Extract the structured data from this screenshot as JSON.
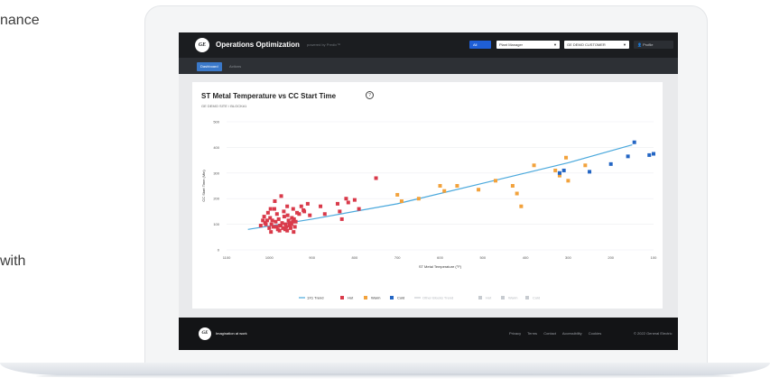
{
  "side_text": {
    "top": "nance",
    "bottom": "with"
  },
  "app": {
    "title": "Operations Optimization",
    "subtitle": "powered by Predix™",
    "logo": "GE"
  },
  "topbar": {
    "all_button": "All",
    "plant_select": "Plant Manager",
    "customer_select": "GE DEMO CUSTOMER",
    "user_menu": "Profile"
  },
  "tabs": [
    {
      "label": "Dashboard",
      "active": true
    },
    {
      "label": "Actions",
      "active": false
    }
  ],
  "chart": {
    "title": "ST Metal Temperature vs CC Start Time",
    "subtitle": "GE DEMO SITE / BLOCK#1",
    "info_icon": "info-icon"
  },
  "chart_data": {
    "type": "scatter",
    "title": "ST Metal Temperature vs CC Start Time",
    "subtitle": "GE DEMO SITE / BLOCK#1",
    "xlabel": "ST Metal Temperature (°F)",
    "ylabel": "CC Start Time (Min)",
    "x_ticks": [
      "1100",
      "1000",
      "900",
      "800",
      "700",
      "600",
      "500",
      "400",
      "300",
      "200",
      "100"
    ],
    "y_ticks": [
      "500",
      "400",
      "300",
      "200",
      "100",
      "0"
    ],
    "xlim": [
      1100,
      100
    ],
    "ylim": [
      0,
      500
    ],
    "grid": true,
    "legend_position": "bottom",
    "legend": [
      "1X1 Trend",
      "Hot",
      "Warm",
      "Cold",
      "Other Blocks Trend",
      "Hot",
      "Warm",
      "Cold"
    ],
    "colors": {
      "trend": "#4aa8dc",
      "hot": "#d93a4a",
      "warm": "#f2a23c",
      "cold": "#2466c4",
      "other": "#c7cbd0"
    },
    "trend": {
      "x": [
        1050,
        900,
        700,
        500,
        300,
        150
      ],
      "y": [
        80,
        120,
        180,
        260,
        340,
        410
      ]
    },
    "series": [
      {
        "name": "Hot",
        "x": [
          1020,
          1010,
          1005,
          1000,
          998,
          995,
          990,
          985,
          982,
          980,
          978,
          975,
          970,
          968,
          965,
          962,
          960,
          958,
          955,
          952,
          950,
          948,
          945,
          942,
          940,
          1012,
          1003,
          996,
          988,
          976,
          966,
          957,
          947,
          938,
          930,
          925,
          918,
          910,
          1008,
          993,
          983,
          973,
          963,
          953,
          943,
          1015,
          997,
          987,
          972,
          958,
          944,
          935,
          920,
          905,
          880,
          870,
          840,
          835,
          830,
          820,
          815,
          800,
          790,
          750
        ],
        "y": [
          95,
          105,
          115,
          85,
          125,
          100,
          90,
          110,
          140,
          80,
          120,
          95,
          105,
          85,
          130,
          100,
          90,
          75,
          115,
          95,
          85,
          100,
          110,
          120,
          90,
          130,
          145,
          70,
          160,
          75,
          150,
          135,
          125,
          110,
          140,
          170,
          150,
          180,
          100,
          115,
          90,
          95,
          80,
          105,
          70,
          115,
          160,
          190,
          210,
          170,
          160,
          145,
          155,
          135,
          170,
          140,
          180,
          150,
          120,
          200,
          185,
          195,
          160,
          280
        ]
      },
      {
        "name": "Warm",
        "x": [
          700,
          690,
          650,
          600,
          590,
          560,
          510,
          470,
          430,
          420,
          410,
          380,
          330,
          320,
          300,
          305,
          260
        ],
        "y": [
          215,
          190,
          200,
          250,
          230,
          250,
          235,
          270,
          250,
          220,
          170,
          330,
          310,
          290,
          270,
          360,
          330
        ]
      },
      {
        "name": "Cold",
        "x": [
          320,
          310,
          250,
          200,
          160,
          145,
          110,
          100
        ],
        "y": [
          300,
          310,
          305,
          335,
          365,
          420,
          370,
          375
        ]
      }
    ]
  },
  "footer": {
    "logo": "GE",
    "tagline": "Imagination at work",
    "links": [
      "Privacy",
      "Terms",
      "Contact",
      "Accessibility",
      "Cookies"
    ],
    "copyright": "© 2022 General Electric"
  }
}
